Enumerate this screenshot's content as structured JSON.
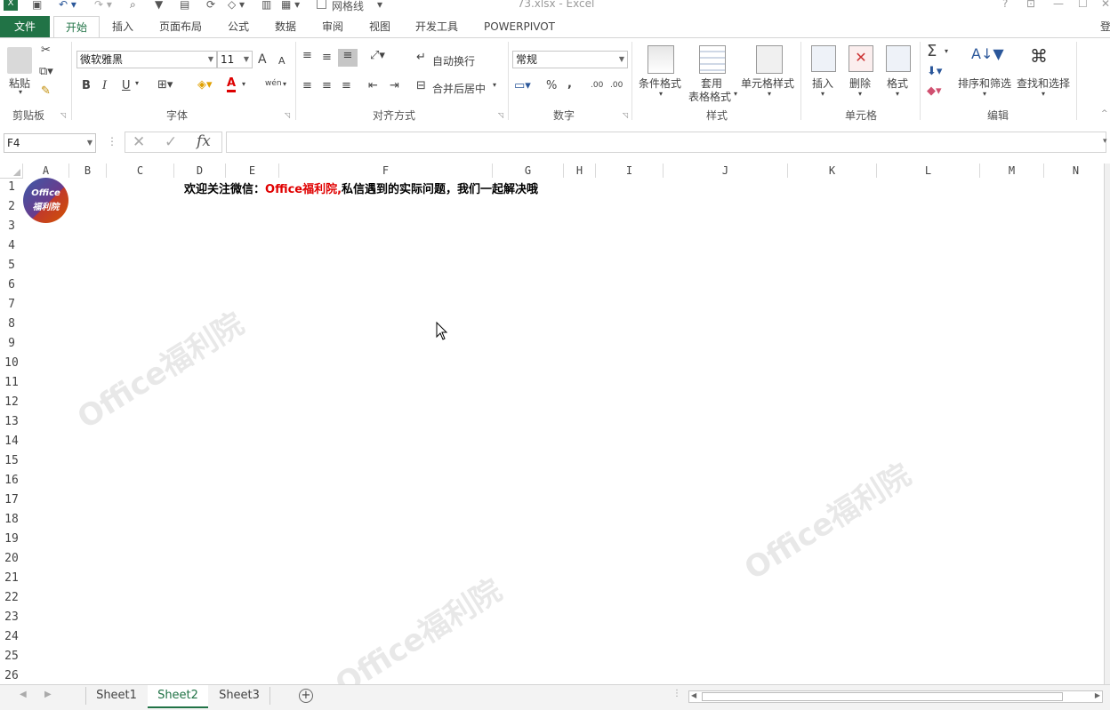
{
  "window": {
    "title": "73.xlsx - Excel",
    "gridlines_label": "网格线",
    "help": "?",
    "login": "登"
  },
  "tabs": [
    {
      "label": "文件"
    },
    {
      "label": "开始"
    },
    {
      "label": "插入"
    },
    {
      "label": "页面布局"
    },
    {
      "label": "公式"
    },
    {
      "label": "数据"
    },
    {
      "label": "审阅"
    },
    {
      "label": "视图"
    },
    {
      "label": "开发工具"
    },
    {
      "label": "POWERPIVOT"
    }
  ],
  "ribbon": {
    "clipboard": {
      "paste": "粘贴",
      "group": "剪贴板"
    },
    "font": {
      "name": "微软雅黑",
      "size": "11",
      "group": "字体",
      "bold": "B",
      "italic": "I",
      "underline": "U",
      "grow": "A",
      "shrink": "A",
      "phonetic": "wén",
      "color": "A"
    },
    "align": {
      "wrap": "自动换行",
      "merge": "合并后居中",
      "group": "对齐方式"
    },
    "number": {
      "format": "常规",
      "group": "数字",
      "percent": "%",
      "comma": ",",
      "inc": ".00",
      "dec": ".00"
    },
    "styles": {
      "cond": "条件格式",
      "table1": "套用",
      "table2": "表格格式",
      "cell": "单元格样式",
      "group": "样式"
    },
    "cells": {
      "insert": "插入",
      "delete": "删除",
      "format": "格式",
      "group": "单元格"
    },
    "edit": {
      "sort": "排序和筛选",
      "find": "查找和选择",
      "group": "编辑"
    }
  },
  "formula_bar": {
    "name_box": "F4",
    "fx": "fx",
    "content": ""
  },
  "columns": [
    "A",
    "B",
    "C",
    "D",
    "E",
    "F",
    "G",
    "H",
    "I",
    "J",
    "K",
    "L",
    "M",
    "N"
  ],
  "rows": [
    "1",
    "2",
    "3",
    "4",
    "5",
    "6",
    "7",
    "8",
    "9",
    "10",
    "11",
    "12",
    "13",
    "14",
    "15",
    "16",
    "17",
    "18",
    "19",
    "20",
    "21",
    "22",
    "23",
    "24",
    "25",
    "26"
  ],
  "cell_text": {
    "part1": "欢迎关注微信：",
    "part2": "Office福利院,",
    "part3": "私信遇到的实际问题，我们一起解决哦"
  },
  "logo": {
    "line1": "Office",
    "line2": "福利院"
  },
  "watermark": "Office福利院",
  "sheets": [
    {
      "name": "Sheet1"
    },
    {
      "name": "Sheet2"
    },
    {
      "name": "Sheet3"
    }
  ],
  "colors": {
    "accent": "#217346",
    "highlight_text": "#e00000"
  }
}
